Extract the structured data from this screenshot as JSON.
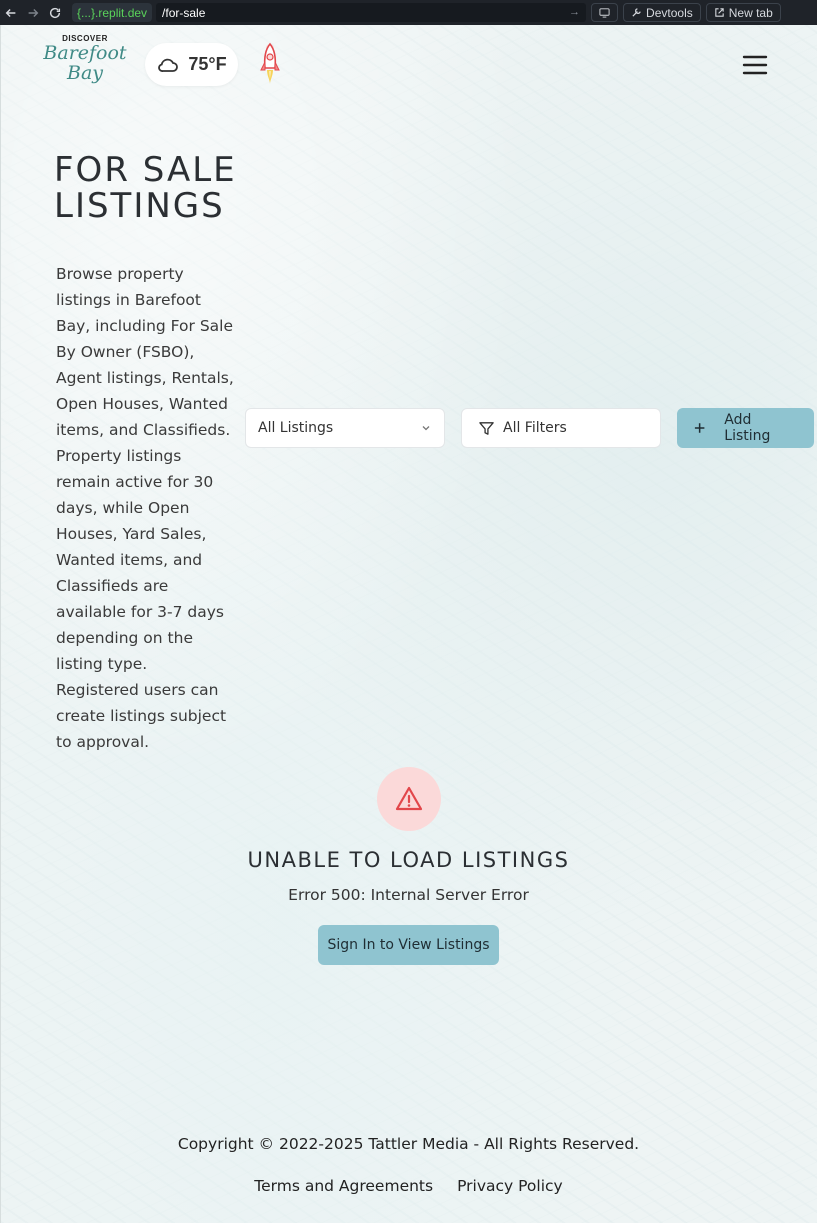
{
  "browser": {
    "url_host": "{...}.replit.dev",
    "url_path": "/for-sale",
    "devtools_label": "Devtools",
    "new_tab_label": "New tab"
  },
  "header": {
    "logo_top": "DISCOVER",
    "logo_line1": "Barefoot",
    "logo_line2": "Bay",
    "weather_temp": "75°F",
    "weather_icon": "cloud-icon"
  },
  "intro": {
    "title": "For Sale Listings",
    "description": "Browse property listings in Barefoot Bay, including For Sale By Owner (FSBO), Agent listings, Rentals, Open Houses, Wanted items, and Classifieds. Property listings remain active for 30 days, while Open Houses, Yard Sales, Wanted items, and Classifieds are available for 3-7 days depending on the listing type. Registered users can create listings subject to approval."
  },
  "controls": {
    "listing_select_value": "All Listings",
    "filters_label": "All Filters",
    "add_listing_label": "Add Listing"
  },
  "error": {
    "title": "Unable to Load Listings",
    "message": "Error 500: Internal Server Error",
    "button_label": "Sign In to View Listings"
  },
  "footer": {
    "copyright": "Copyright © 2022-2025 Tattler Media - All Rights Reserved.",
    "terms_label": "Terms and Agreements",
    "privacy_label": "Privacy Policy"
  },
  "colors": {
    "accent": "#8fc4d0",
    "error_bg": "#fbd9d9",
    "error_icon": "#e2474b",
    "logo": "#3f8a86"
  }
}
